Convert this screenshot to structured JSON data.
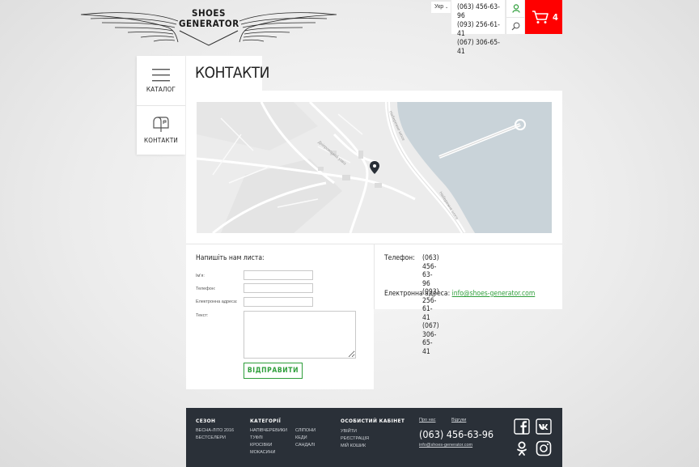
{
  "header": {
    "logo_text_line1": "SHOES",
    "logo_text_line2": "GENERATOR",
    "language": "Укр",
    "phones": [
      "(063) 456-63-96",
      "(093) 256-61-41",
      "(067) 306-65-41"
    ],
    "cart_count": "4",
    "icons": [
      "user-icon",
      "search-icon",
      "cart-icon"
    ],
    "accent_color": "#ff0000",
    "green_color": "#2e9e3a"
  },
  "side_menu": [
    {
      "label": "КАТАЛОГ",
      "icon": "hamburger-icon"
    },
    {
      "label": "КОНТАКТИ",
      "icon": "mailbox-icon"
    }
  ],
  "page_title": "КОНТАКТИ",
  "map": {
    "road_labels": [
      "Набережне шосе",
      "Набережне шосе",
      "Дніпровський узвіз"
    ]
  },
  "form": {
    "title": "Напишіть нам листа:",
    "fields": [
      {
        "label": "Ім'я:",
        "value": ""
      },
      {
        "label": "Телефон:",
        "value": ""
      },
      {
        "label": "Електронна адреса:",
        "value": ""
      }
    ],
    "text_label": "Текст:",
    "submit_label": "ВІДПРАВИТИ"
  },
  "contacts": {
    "phone_label": "Телефон:",
    "phones": [
      "(063) 456-63-96",
      "(093) 256-61-41",
      "(067) 306-65-41"
    ],
    "email_label": "Електронна адреса:",
    "email": "info@shoes-generator.com"
  },
  "footer": {
    "season": {
      "heading": "СЕЗОН",
      "items": [
        "ВЕСНА-ЛІТО 2016",
        "БЕСТСЕЛЕРИ"
      ]
    },
    "categories": {
      "heading": "КАТЕГОРІЇ",
      "col1": [
        "НАПІВЧЕРЕВИКИ",
        "ТУФЛІ",
        "КРОСІВКИ",
        "МОКАСИНИ"
      ],
      "col2": [
        "СЛІПОНИ",
        "КЕДИ",
        "САНДАЛІ"
      ]
    },
    "account": {
      "heading": "ОСОБИСТИЙ КАБІНЕТ",
      "items": [
        "УВІЙТИ",
        "РЕЄСТРАЦІЯ",
        "МІЙ КОШИК"
      ]
    },
    "about_link": "Про нас",
    "shipping_link": "Відгуки",
    "phone": "(063) 456-63-96",
    "email": "info@shoes-generator.com",
    "social": [
      "facebook-icon",
      "vk-icon",
      "odnoklassniki-icon",
      "instagram-icon"
    ]
  }
}
